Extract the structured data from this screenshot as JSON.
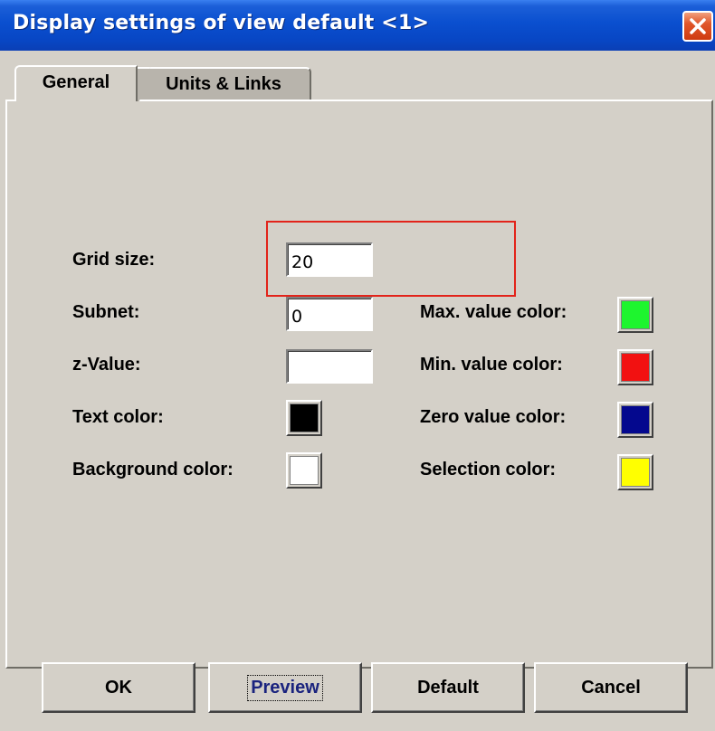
{
  "window": {
    "title": "Display settings of view default <1>"
  },
  "tabs": [
    {
      "label": "General",
      "selected": true
    },
    {
      "label": "Units & Links",
      "selected": false
    }
  ],
  "general": {
    "grid_size": {
      "label": "Grid size:",
      "value": "20"
    },
    "subnet": {
      "label": "Subnet:",
      "value": "0"
    },
    "z_value": {
      "label": "z-Value:",
      "value": ""
    },
    "text_color": {
      "label": "Text color:",
      "color": "#000000"
    },
    "background_color": {
      "label": "Background color:",
      "color": "#ffffff"
    },
    "max_value_color": {
      "label": "Max. value color:",
      "color": "#1ef52e"
    },
    "min_value_color": {
      "label": "Min. value color:",
      "color": "#f21111"
    },
    "zero_value_color": {
      "label": "Zero value color:",
      "color": "#04088e"
    },
    "selection_color": {
      "label": "Selection color:",
      "color": "#ffff00"
    }
  },
  "buttons": {
    "ok": "OK",
    "preview": "Preview",
    "default": "Default",
    "cancel": "Cancel"
  },
  "colors": {
    "titlebar": "#0a4fcf",
    "highlight_box": "#e2231a"
  }
}
